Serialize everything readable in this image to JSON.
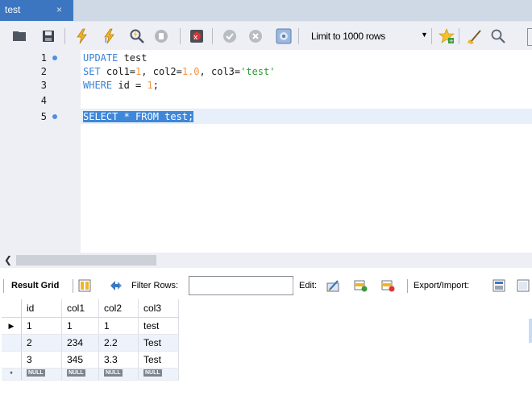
{
  "tab": {
    "title": "test",
    "close": "×"
  },
  "toolbar": {
    "limit_label": "Limit to 1000 rows",
    "limit_arrow": "▼"
  },
  "editor": {
    "lines": [
      {
        "n": "1",
        "text": "UPDATE test"
      },
      {
        "n": "2",
        "text": "SET col1=1, col2=1.0, col3='test'"
      },
      {
        "n": "3",
        "text": "WHERE id = 1;"
      },
      {
        "n": "4",
        "text": ""
      },
      {
        "n": "5",
        "text": "SELECT * FROM test;"
      }
    ],
    "tokens": {
      "l1_kw": "UPDATE",
      "l1_rest": " test",
      "l2_kw": "SET",
      "l2_a": " col1=",
      "l2_n1": "1",
      "l2_b": ", col2=",
      "l2_n2": "1.0",
      "l2_c": ", col3=",
      "l2_s": "'test'",
      "l3_kw": "WHERE",
      "l3_a": " id = ",
      "l3_n": "1",
      "l3_b": ";",
      "l5": "SELECT * FROM test;"
    }
  },
  "results": {
    "result_grid_label": "Result Grid",
    "filter_rows_label": "Filter Rows:",
    "filter_value": "",
    "edit_label": "Edit:",
    "export_label": "Export/Import:",
    "columns": [
      "id",
      "col1",
      "col2",
      "col3"
    ],
    "rows": [
      [
        "1",
        "1",
        "1",
        "test"
      ],
      [
        "2",
        "234",
        "2.2",
        "Test"
      ],
      [
        "3",
        "345",
        "3.3",
        "Test"
      ]
    ],
    "null_badge": "NULL",
    "current_row_marker": "▶",
    "new_row_marker": "*"
  }
}
